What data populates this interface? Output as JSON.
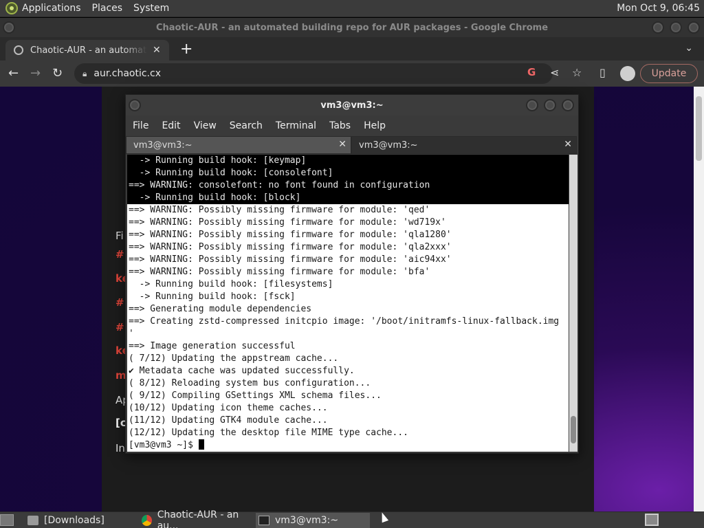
{
  "top_panel": {
    "menus": [
      "Applications",
      "Places",
      "System"
    ],
    "clock": "Mon Oct  9, 06:45"
  },
  "chrome": {
    "window_title": "Chaotic-AUR - an automated building repo for AUR packages - Google Chrome",
    "tab_label": "Chaotic-AUR - an automated building repo for AUR packages",
    "tab_close": "✕",
    "new_tab": "+",
    "url": "aur.chaotic.cx",
    "update_label": "Update"
  },
  "page": {
    "lines": [
      {
        "text": "Fi",
        "color": "#e8e8e8"
      },
      {
        "text": "#",
        "color": "#e0453a"
      },
      {
        "text": "ke",
        "color": "#e0453a"
      },
      {
        "text": "#",
        "color": "#e0453a"
      },
      {
        "text": "#",
        "color": "#e0453a"
      },
      {
        "text": "ke",
        "color": "#e0453a"
      },
      {
        "text": "m",
        "color": "#e0453a"
      },
      {
        "text": "Ap",
        "color": "#e8e8e8"
      },
      {
        "text": "[c",
        "color": "#ffffff"
      },
      {
        "text": "In",
        "color": "#e8e8e8"
      }
    ]
  },
  "terminal": {
    "title": "vm3@vm3:~",
    "menus": [
      "File",
      "Edit",
      "View",
      "Search",
      "Terminal",
      "Tabs",
      "Help"
    ],
    "tabs": [
      "vm3@vm3:~",
      "vm3@vm3:~"
    ],
    "lines": [
      {
        "text": "  -> Running build hook: [keymap]",
        "dark": true
      },
      {
        "text": "  -> Running build hook: [consolefont]",
        "dark": true
      },
      {
        "text": "==> WARNING: consolefont: no font found in configuration",
        "dark": true
      },
      {
        "text": "  -> Running build hook: [block]",
        "dark": true
      },
      {
        "text": "==> WARNING: Possibly missing firmware for module: 'qed'",
        "dark": false
      },
      {
        "text": "==> WARNING: Possibly missing firmware for module: 'wd719x'",
        "dark": false
      },
      {
        "text": "==> WARNING: Possibly missing firmware for module: 'qla1280'",
        "dark": false
      },
      {
        "text": "==> WARNING: Possibly missing firmware for module: 'qla2xxx'",
        "dark": false
      },
      {
        "text": "==> WARNING: Possibly missing firmware for module: 'aic94xx'",
        "dark": false
      },
      {
        "text": "==> WARNING: Possibly missing firmware for module: 'bfa'",
        "dark": false
      },
      {
        "text": "  -> Running build hook: [filesystems]",
        "dark": false
      },
      {
        "text": "  -> Running build hook: [fsck]",
        "dark": false
      },
      {
        "text": "==> Generating module dependencies",
        "dark": false
      },
      {
        "text": "==> Creating zstd-compressed initcpio image: '/boot/initramfs-linux-fallback.img",
        "dark": false
      },
      {
        "text": "'",
        "dark": false
      },
      {
        "text": "==> Image generation successful",
        "dark": false
      },
      {
        "text": "( 7/12) Updating the appstream cache...",
        "dark": false
      },
      {
        "text": "✔ Metadata cache was updated successfully.",
        "dark": false
      },
      {
        "text": "( 8/12) Reloading system bus configuration...",
        "dark": false
      },
      {
        "text": "( 9/12) Compiling GSettings XML schema files...",
        "dark": false
      },
      {
        "text": "(10/12) Updating icon theme caches...",
        "dark": false
      },
      {
        "text": "(11/12) Updating GTK4 module cache...",
        "dark": false
      },
      {
        "text": "(12/12) Updating the desktop file MIME type cache...",
        "dark": false
      }
    ],
    "prompt": "[vm3@vm3 ~]$ "
  },
  "taskbar": {
    "tasks": [
      {
        "label": "[Downloads]",
        "icon": "folder-icon"
      },
      {
        "label": "Chaotic-AUR - an au...",
        "icon": "chrome-icon"
      },
      {
        "label": "vm3@vm3:~",
        "icon": "terminal-icon"
      }
    ]
  }
}
